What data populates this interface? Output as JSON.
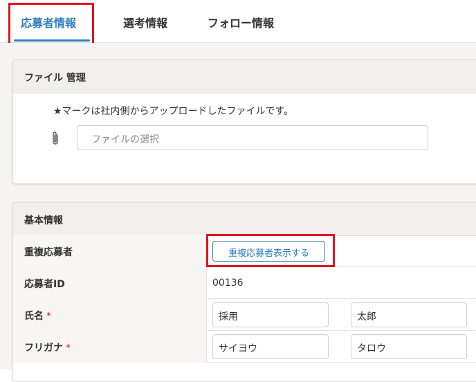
{
  "tabs": [
    {
      "label": "応募者情報",
      "active": true
    },
    {
      "label": "選考情報",
      "active": false
    },
    {
      "label": "フォロー情報",
      "active": false
    }
  ],
  "file_section": {
    "title": "ファイル 管理",
    "notice": "★マークは社内側からアップロードしたファイルです。",
    "file_input_placeholder": "ファイルの選択",
    "icon": "paperclip-icon"
  },
  "basic_info": {
    "title": "基本情報",
    "duplicate_label": "重複応募者",
    "duplicate_button": "重複応募者表示する",
    "applicant_id_label": "応募者ID",
    "applicant_id_value": "00136",
    "name_label": "氏名",
    "name_required": "*",
    "last_name": "採用",
    "first_name": "太郎",
    "kana_label": "フリガナ",
    "kana_required": "*",
    "last_name_kana": "サイヨウ",
    "first_name_kana": "タロウ"
  },
  "colors": {
    "accent": "#2f7ec2",
    "highlight": "#e0141e",
    "required": "#e0141e"
  }
}
